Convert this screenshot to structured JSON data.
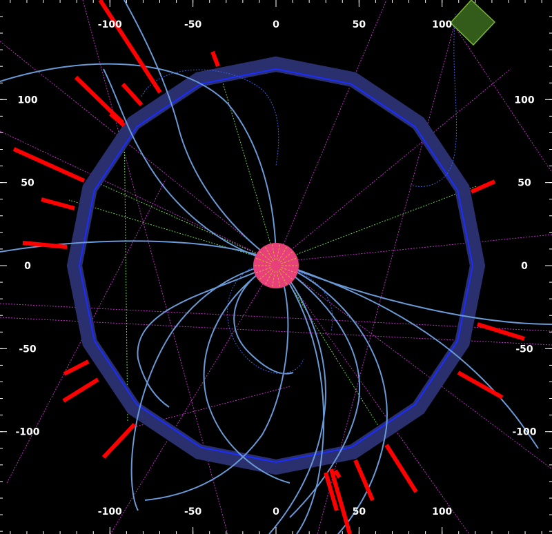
{
  "scale": {
    "top_labels": [
      "-100",
      "-50",
      "0",
      "50",
      "100"
    ],
    "bottom_labels": [
      "-100",
      "-50",
      "0",
      "50",
      "100"
    ],
    "left_labels": [
      "100",
      "50",
      "0",
      "-50",
      "-100"
    ],
    "right_labels": [
      "100",
      "50",
      "0",
      "-50",
      "-100"
    ],
    "top_values": [
      -100,
      -50,
      0,
      50,
      100
    ],
    "left_values": [
      100,
      50,
      0,
      -50,
      -100
    ]
  },
  "detector": {
    "ring_color": "#2a2f6e",
    "ring_edge_color": "#1a2cff",
    "core_color": "#e8407a",
    "polygon_sides": 16
  },
  "colors": {
    "track": "#6a9ad6",
    "energy_deposit": "#ff0000",
    "dotted_magenta": "#c030c8",
    "dotted_green": "#6cd64c",
    "dotted_blue": "#3a60e0",
    "box_fill": "#335c1a",
    "box_edge": "#7ab43a"
  },
  "objects": {
    "track_count": 14,
    "energy_deposit_count": 20,
    "box_icon": "green-square-cell"
  }
}
